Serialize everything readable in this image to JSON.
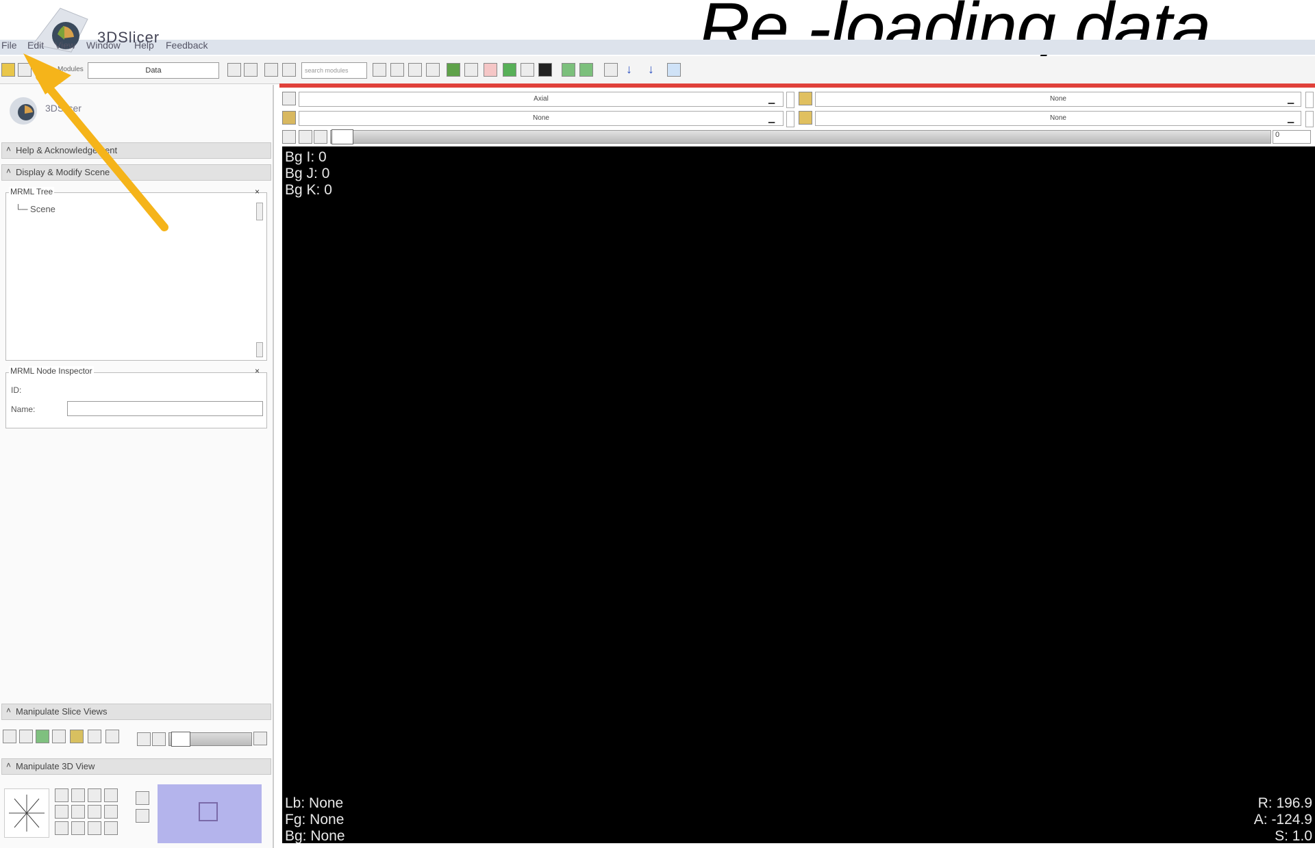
{
  "slide": {
    "title": "Re -loading data"
  },
  "app": {
    "logo_text": "3DSlicer",
    "panel_logo_text": "3DSlicer"
  },
  "menu": {
    "items": [
      "File",
      "Edit",
      "View",
      "Window",
      "Help",
      "Feedback"
    ]
  },
  "toolbar": {
    "modules_label": "Modules",
    "module_value": "Data",
    "search_placeholder": "search modules"
  },
  "sections": {
    "help": "Help & Acknowledgement",
    "display_modify": "Display & Modify Scene",
    "mrml_tree_title": "MRML Tree",
    "mrml_tree_root": "Scene",
    "inspector_title": "MRML Node Inspector",
    "inspector_id_label": "ID:",
    "inspector_name_label": "Name:",
    "manipulate_slice": "Manipulate Slice Views",
    "manipulate_3d": "Manipulate 3D View"
  },
  "view_controls": {
    "orientation": "Axial",
    "fg_layer": "None",
    "bg_layer": "None",
    "label_layer": "None",
    "offset_value": "0"
  },
  "overlay": {
    "bg_i": "Bg I: 0",
    "bg_j": "Bg J: 0",
    "bg_k": "Bg K: 0",
    "lb": "Lb: None",
    "fg": "Fg: None",
    "bg": "Bg: None",
    "r": "R: 196.9",
    "a": "A: -124.9",
    "s": "S: 1.0"
  },
  "colors": {
    "arrow": "#f5b41a",
    "red_bar": "#e0413a",
    "viewport_bg": "#000000",
    "thumb_3d": "#b4b4ec"
  },
  "icons": [
    "close-icon",
    "arrow-icon",
    "load-icon",
    "save-icon",
    "search-icon",
    "home-icon",
    "undo-icon",
    "redo-icon"
  ]
}
